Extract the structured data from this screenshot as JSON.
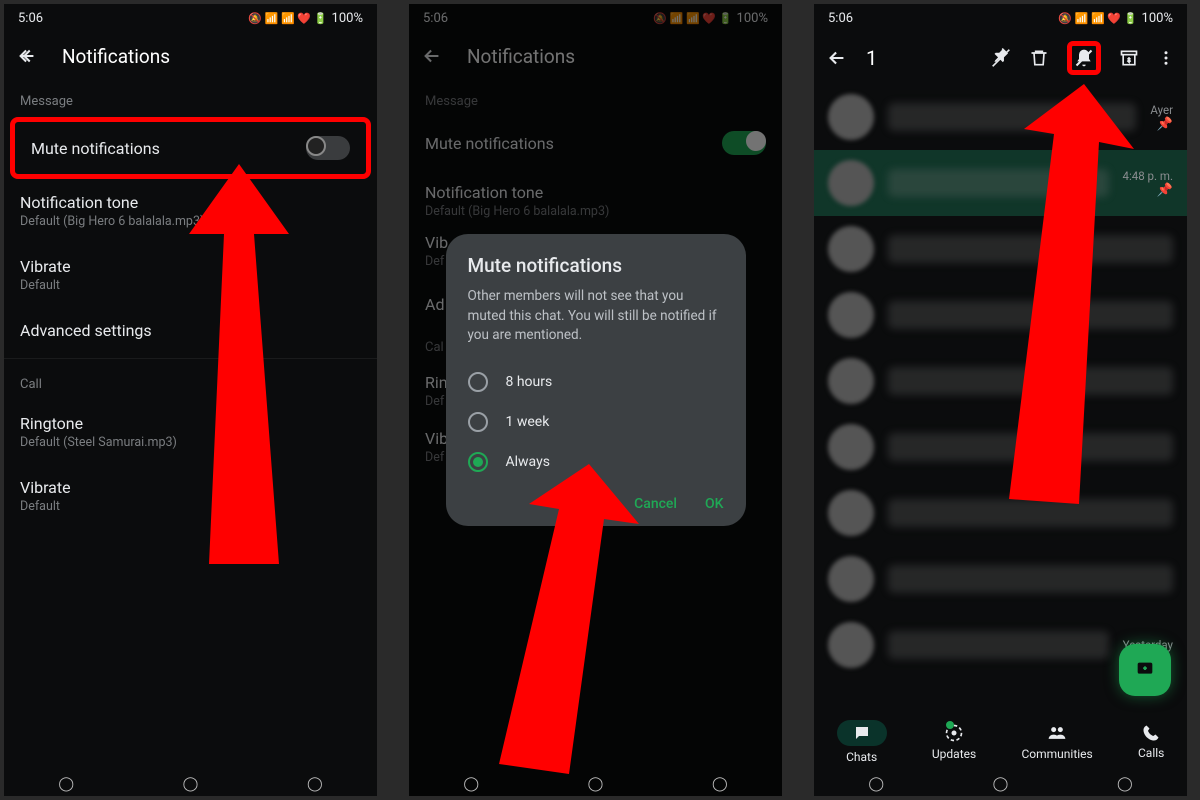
{
  "status": {
    "time": "5:06",
    "battery": "100%"
  },
  "screen1": {
    "title": "Notifications",
    "section_msg": "Message",
    "mute": "Mute notifications",
    "tone": "Notification tone",
    "tone_sub": "Default (Big Hero 6 balalala.mp3)",
    "vibrate": "Vibrate",
    "vibrate_sub": "Default",
    "advanced": "Advanced settings",
    "section_call": "Call",
    "ringtone": "Ringtone",
    "ringtone_sub": "Default (Steel Samurai.mp3)",
    "vibrate2": "Vibrate",
    "vibrate2_sub": "Default"
  },
  "screen2": {
    "title": "Notifications",
    "section_msg": "Message",
    "mute": "Mute notifications",
    "tone": "Notification tone",
    "tone_sub": "Default (Big Hero 6 balalala.mp3)",
    "vib_short": "Vib",
    "def_short": "Def",
    "adv_short": "Ad",
    "call_short": "Cal",
    "ring_short": "Rin",
    "dialog": {
      "title": "Mute notifications",
      "desc": "Other members will not see that you muted this chat. You will still be notified if you are mentioned.",
      "opt1": "8 hours",
      "opt2": "1 week",
      "opt3": "Always",
      "cancel": "Cancel",
      "ok": "OK"
    }
  },
  "screen3": {
    "count": "1",
    "time1": "Ayer",
    "time2": "4:48 p. m.",
    "yesterday": "Yesterday",
    "nav": {
      "chats": "Chats",
      "updates": "Updates",
      "communities": "Communities",
      "calls": "Calls"
    }
  }
}
